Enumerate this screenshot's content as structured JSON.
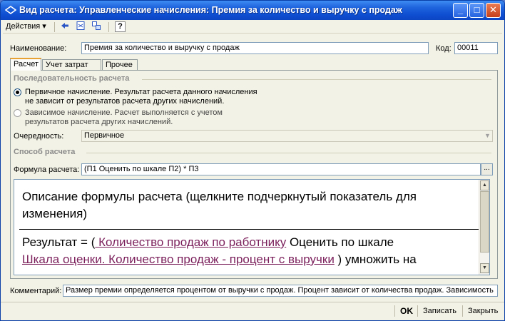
{
  "window": {
    "title": "Вид расчета: Управленческие начисления: Премия за количество и выручку с продаж",
    "minimize": "_",
    "maximize": "□",
    "close": "✕"
  },
  "toolbar": {
    "actions_label": "Действия ▾",
    "help_label": "?"
  },
  "fields": {
    "name_label": "Наименование:",
    "name_value": "Премия за количество и выручку с продаж",
    "code_label": "Код:",
    "code_value": "00011"
  },
  "tabs": [
    {
      "label": "Расчет"
    },
    {
      "label": "Учет затрат"
    },
    {
      "label": "Прочее"
    }
  ],
  "sequence": {
    "group_title": "Последовательность расчета",
    "primary_line1": "Первичное начисление. Результат расчета данного начисления",
    "primary_line2": "не зависит от результатов расчета других начислений.",
    "dependent_line1": "Зависимое начисление. Расчет выполняется с учетом",
    "dependent_line2": "результатов расчета других начислений.",
    "order_label": "Очередность:",
    "order_value": "Первичное",
    "order_arrow": "▼"
  },
  "method": {
    "group_title": "Способ расчета",
    "formula_label": "Формула расчета:",
    "formula_value": "(П1 Оценить по шкале П2) * П3",
    "dots": "..."
  },
  "description": {
    "heading": "Описание формулы расчета (щелкните подчеркнутый показатель для изменения)",
    "result_prefix": "Результат = (",
    "link1": " Количество продаж по работнику",
    "middle": " Оценить по шкале",
    "link2": "Шкала оценки. Количество продаж - процент с выручки",
    "suffix": " ) умножить на",
    "scroll_up": "▲",
    "scroll_down": "▼"
  },
  "comment": {
    "label": "Комментарий:",
    "value": "Размер премии определяется процентом от выручки с продаж. Процент зависит от количества продаж. Зависимость"
  },
  "buttons": {
    "ok": "OK",
    "save": "Записать",
    "close": "Закрыть"
  }
}
